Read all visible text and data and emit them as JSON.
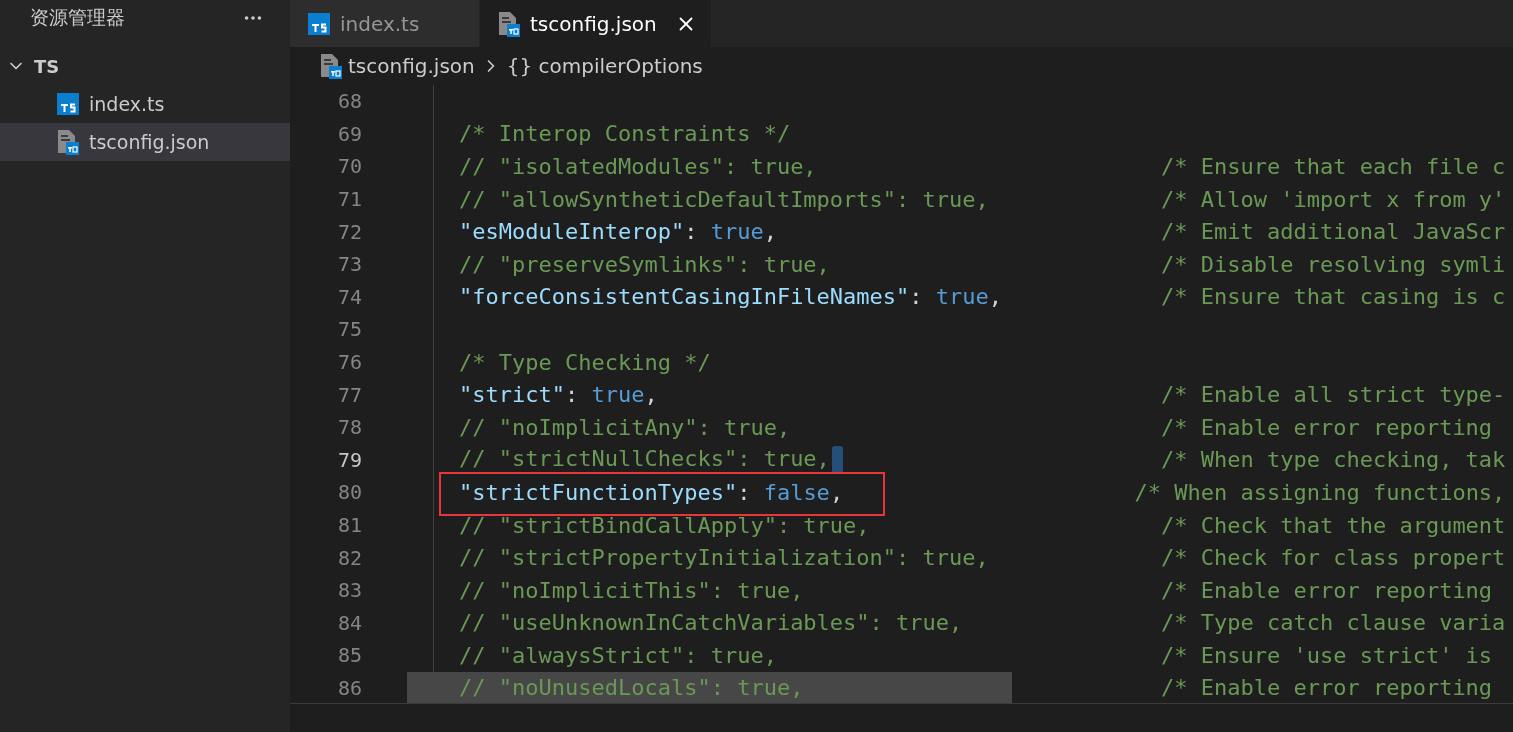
{
  "sidebar": {
    "title": "资源管理器",
    "folder": {
      "name": "TS",
      "expanded": true,
      "children": [
        {
          "name": "index.ts",
          "kind": "ts",
          "selected": false
        },
        {
          "name": "tsconfig.json",
          "kind": "json",
          "selected": true
        }
      ]
    }
  },
  "tabs": [
    {
      "label": "index.ts",
      "kind": "ts",
      "selected": false
    },
    {
      "label": "tsconfig.json",
      "kind": "json",
      "selected": true
    }
  ],
  "breadcrumb": {
    "file": "tsconfig.json",
    "symbol": "{}",
    "name": "compilerOptions"
  },
  "lines": [
    {
      "number": "68",
      "current": false,
      "selection": false,
      "annotated": false
    },
    {
      "number": "69",
      "tokens": [
        {
          "t": "/* Interop Constraints */",
          "kind": "comment"
        }
      ],
      "current": false,
      "selection": false,
      "annotated": false
    },
    {
      "number": "70",
      "tokens": [
        {
          "t": "// \"isolatedModules\": true,",
          "kind": "comment"
        }
      ],
      "comment": "/* Ensure that each file c",
      "current": false,
      "selection": false,
      "annotated": false
    },
    {
      "number": "71",
      "tokens": [
        {
          "t": "// \"allowSyntheticDefaultImports\": true,",
          "kind": "comment"
        }
      ],
      "comment": "/* Allow 'import x from y'",
      "current": false,
      "selection": false,
      "annotated": false
    },
    {
      "number": "72",
      "tokens": [
        {
          "t": "\"esModuleInterop\"",
          "kind": "key"
        },
        {
          "t": ":",
          "kind": "punct"
        },
        {
          "t": "true",
          "kind": "bool"
        },
        {
          "t": ",",
          "kind": "punct"
        }
      ],
      "comment": "/* Emit additional JavaScr",
      "current": false,
      "selection": false,
      "annotated": false
    },
    {
      "number": "73",
      "tokens": [
        {
          "t": "// \"preserveSymlinks\": true,",
          "kind": "comment"
        }
      ],
      "comment": "/* Disable resolving symli",
      "current": false,
      "selection": false,
      "annotated": false
    },
    {
      "number": "74",
      "tokens": [
        {
          "t": "\"forceConsistentCasingInFileNames\"",
          "kind": "key"
        },
        {
          "t": ":",
          "kind": "punct"
        },
        {
          "t": "true",
          "kind": "bool"
        },
        {
          "t": ",",
          "kind": "punct"
        }
      ],
      "comment": "/* Ensure that casing is c",
      "current": false,
      "selection": false,
      "annotated": false
    },
    {
      "number": "75",
      "current": false,
      "selection": false,
      "annotated": false
    },
    {
      "number": "76",
      "tokens": [
        {
          "t": "/* Type Checking */",
          "kind": "comment"
        }
      ],
      "current": false,
      "selection": false,
      "annotated": false
    },
    {
      "number": "77",
      "tokens": [
        {
          "t": "\"strict\"",
          "kind": "key"
        },
        {
          "t": ":",
          "kind": "punct"
        },
        {
          "t": "true",
          "kind": "bool"
        },
        {
          "t": ",",
          "kind": "punct"
        }
      ],
      "comment": "/* Enable all strict type-",
      "current": false,
      "selection": false,
      "annotated": false
    },
    {
      "number": "78",
      "tokens": [
        {
          "t": "// \"noImplicitAny\": true,",
          "kind": "comment"
        }
      ],
      "comment": "/* Enable error reporting",
      "current": false,
      "selection": false,
      "annotated": false
    },
    {
      "number": "79",
      "tokens": [
        {
          "t": "// \"strictNullChecks\": true,",
          "kind": "comment"
        }
      ],
      "comment": "/* When type checking, tak",
      "current": true,
      "selection": false,
      "annotated": false
    },
    {
      "number": "80",
      "tokens": [
        {
          "t": "\"strictFunctionTypes\"",
          "kind": "key"
        },
        {
          "t": ":",
          "kind": "punct"
        },
        {
          "t": "false",
          "kind": "bool"
        },
        {
          "t": ",",
          "kind": "punct"
        }
      ],
      "comment": "/* When assigning functions,",
      "current": false,
      "selection": false,
      "annotated": true
    },
    {
      "number": "81",
      "tokens": [
        {
          "t": "// \"strictBindCallApply\": true,",
          "kind": "comment"
        }
      ],
      "comment": "/* Check that the argument",
      "current": false,
      "selection": false,
      "annotated": false
    },
    {
      "number": "82",
      "tokens": [
        {
          "t": "// \"strictPropertyInitialization\": true,",
          "kind": "comment"
        }
      ],
      "comment": "/* Check for class propert",
      "current": false,
      "selection": false,
      "annotated": false
    },
    {
      "number": "83",
      "tokens": [
        {
          "t": "// \"noImplicitThis\": true,",
          "kind": "comment"
        }
      ],
      "comment": "/* Enable error reporting",
      "current": false,
      "selection": false,
      "annotated": false
    },
    {
      "number": "84",
      "tokens": [
        {
          "t": "// \"useUnknownInCatchVariables\": true,",
          "kind": "comment"
        }
      ],
      "comment": "/* Type catch clause varia",
      "current": false,
      "selection": false,
      "annotated": false
    },
    {
      "number": "85",
      "tokens": [
        {
          "t": "// \"alwaysStrict\": true,",
          "kind": "comment"
        }
      ],
      "comment": "/* Ensure 'use strict' is",
      "current": false,
      "selection": false,
      "annotated": false
    },
    {
      "number": "86",
      "tokens": [
        {
          "t": "// \"noUnusedLocals\": true,",
          "kind": "comment"
        }
      ],
      "comment": "/* Enable error reporting",
      "current": false,
      "selection": true,
      "annotated": false
    }
  ]
}
